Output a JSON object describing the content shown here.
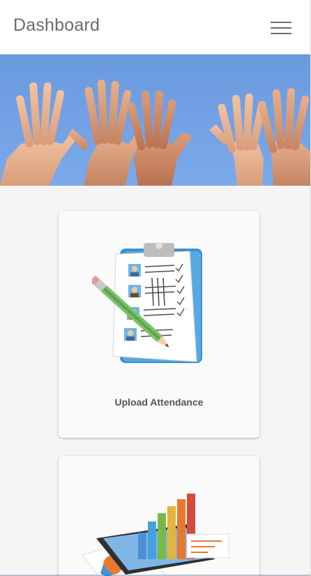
{
  "header": {
    "title": "Dashboard",
    "menu_icon": "hamburger-menu-icon"
  },
  "hero": {
    "image": "raised-hands-banner",
    "sky_color": "#6e9fe0"
  },
  "cards": [
    {
      "label": "Upload Attendance",
      "icon": "clipboard-checklist-icon"
    },
    {
      "label": "",
      "icon": "bar-chart-tablet-icon"
    }
  ],
  "colors": {
    "background": "#f5f5f5",
    "header_bg": "#ffffff",
    "title_text": "#6b6b6b",
    "card_bg": "#fafafa"
  }
}
